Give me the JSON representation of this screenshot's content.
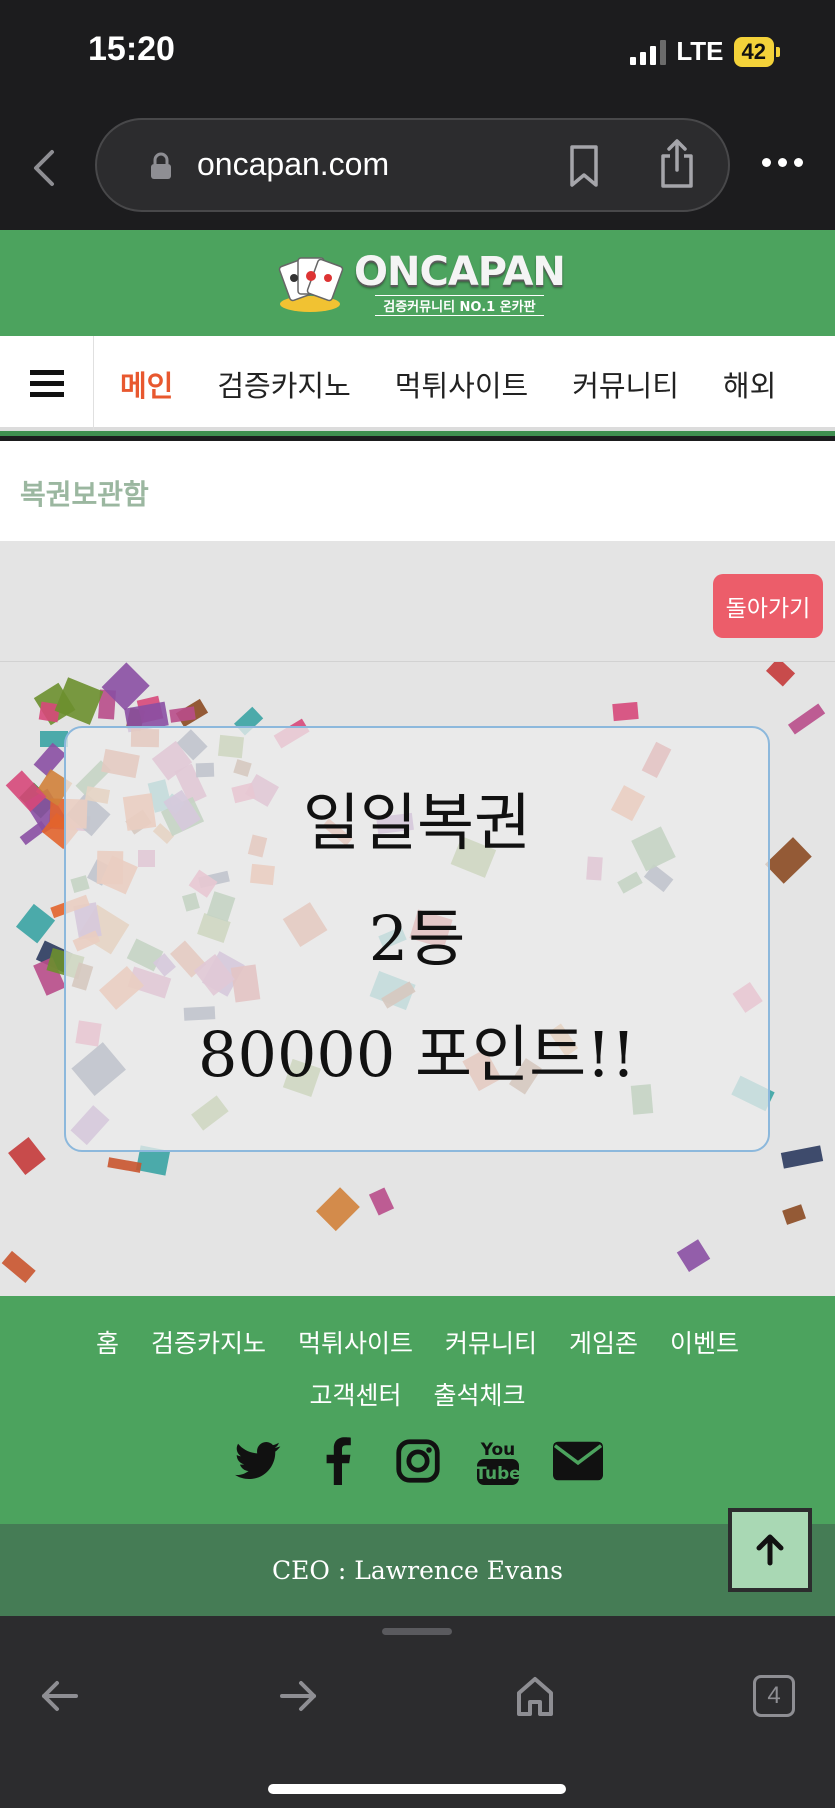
{
  "status_bar": {
    "time": "15:20",
    "network": "LTE",
    "battery": "42"
  },
  "browser": {
    "url": "oncapan.com",
    "icons": [
      "back-chevron-icon",
      "lock-icon",
      "bookmark-icon",
      "share-icon",
      "more-icon"
    ]
  },
  "header": {
    "logo_title": "ONCAPAN",
    "logo_subtitle": "검증커뮤니티 NO.1 온카판",
    "brand_color": "#4ca35e"
  },
  "nav": {
    "items": [
      "메인",
      "검증카지노",
      "먹튀사이트",
      "커뮤니티",
      "해외"
    ],
    "active_index": 0,
    "active_color": "#e8582f"
  },
  "breadcrumb": "복권보관함",
  "back_button_label": "돌아가기",
  "lottery": {
    "name": "일일복권",
    "rank": "2등",
    "prize": "80000 포인트!!"
  },
  "footer": {
    "links": [
      "홈",
      "검증카지노",
      "먹튀사이트",
      "커뮤니티",
      "게임존",
      "이벤트",
      "고객센터",
      "출석체크"
    ],
    "social_icons": [
      "twitter-icon",
      "facebook-icon",
      "instagram-icon",
      "youtube-icon",
      "email-icon"
    ],
    "ceo": "CEO : Lawrence Evans"
  },
  "toolbar": {
    "tabs_count": "4"
  }
}
